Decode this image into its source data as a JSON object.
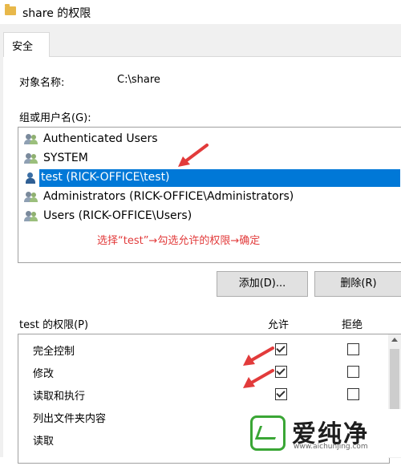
{
  "window": {
    "title": "share 的权限"
  },
  "tabs": [
    {
      "label": "安全"
    }
  ],
  "object": {
    "label": "对象名称:",
    "value": "C:\\share"
  },
  "users": {
    "label": "组或用户名(G):",
    "items": [
      {
        "name": "Authenticated Users",
        "icon": "group-icon"
      },
      {
        "name": "SYSTEM",
        "icon": "group-icon"
      },
      {
        "name": "test (RICK-OFFICE\\test)",
        "icon": "user-icon",
        "selected": true
      },
      {
        "name": "Administrators (RICK-OFFICE\\Administrators)",
        "icon": "group-icon"
      },
      {
        "name": "Users (RICK-OFFICE\\Users)",
        "icon": "group-icon"
      }
    ]
  },
  "annotation": "选择“test”→勾选允许的权限→确定",
  "buttons": {
    "add": "添加(D)...",
    "remove": "删除(R)"
  },
  "permissions": {
    "label": "test 的权限(P)",
    "allow_header": "允许",
    "deny_header": "拒绝",
    "rows": [
      {
        "name": "完全控制",
        "allow": true,
        "deny": false,
        "show_boxes": true
      },
      {
        "name": "修改",
        "allow": true,
        "deny": false,
        "show_boxes": true
      },
      {
        "name": "读取和执行",
        "allow": true,
        "deny": false,
        "show_boxes": true
      },
      {
        "name": "列出文件夹内容",
        "allow": false,
        "deny": false,
        "show_boxes": false
      },
      {
        "name": "读取",
        "allow": false,
        "deny": false,
        "show_boxes": false
      }
    ]
  },
  "watermark": {
    "text": "爱纯净",
    "url": "www.aichunjing.com"
  },
  "colors": {
    "selection": "#0078d7",
    "annotation": "#e23b3b",
    "brand": "#3aa635"
  }
}
